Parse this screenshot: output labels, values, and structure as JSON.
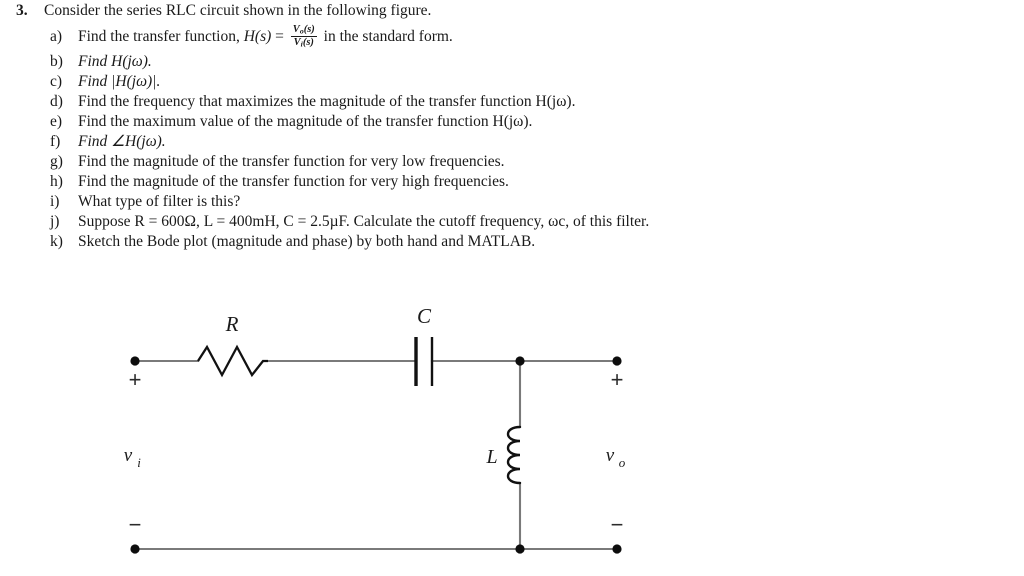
{
  "problem": {
    "number": "3.",
    "statement": "Consider the series RLC circuit shown in the following figure.",
    "parts": [
      {
        "marker": "a)",
        "text_before": "Find the transfer function, ",
        "math_lead": "H(s)",
        "equals": " = ",
        "fraction_numerator": "V",
        "fraction_numerator_sub": "o",
        "fraction_numerator_arg": "(s)",
        "fraction_denominator": "V",
        "fraction_denominator_sub": "i",
        "fraction_denominator_arg": "(s)",
        "text_after": " in the standard form."
      },
      {
        "marker": "b)",
        "text": "Find H(jω)."
      },
      {
        "marker": "c)",
        "text": "Find |H(jω)|."
      },
      {
        "marker": "d)",
        "text": "Find the frequency that maximizes the magnitude of the transfer function H(jω)."
      },
      {
        "marker": "e)",
        "text": "Find the maximum value of the magnitude of the transfer function H(jω)."
      },
      {
        "marker": "f)",
        "text": "Find ∠H(jω)."
      },
      {
        "marker": "g)",
        "text": "Find the magnitude of the transfer function for very low frequencies."
      },
      {
        "marker": "h)",
        "text": "Find the magnitude of the transfer function for very high frequencies."
      },
      {
        "marker": "i)",
        "text": "What type of filter is this?"
      },
      {
        "marker": "j)",
        "text": "Suppose R = 600Ω, L = 400mH, C = 2.5µF. Calculate the cutoff frequency, ωc, of this filter."
      },
      {
        "marker": "k)",
        "text": "Sketch the Bode plot (magnitude and phase) by both hand and MATLAB."
      }
    ]
  },
  "circuit": {
    "title": "series RLC circuit",
    "components": {
      "resistor_label": "R",
      "capacitor_label": "C",
      "inductor_label": "L"
    },
    "port_labels": {
      "input_voltage": "v",
      "input_voltage_sub": "i",
      "output_voltage": "v",
      "output_voltage_sub": "o"
    },
    "polarity": {
      "input_positive": "+",
      "input_negative": "−",
      "output_positive": "+",
      "output_negative": "−"
    },
    "given_values": {
      "R": "600Ω",
      "L": "400mH",
      "C": "2.5µF"
    },
    "topology": "R in series, C in series, L shunt to ground; output across L"
  },
  "colors": {
    "ink": "#1a1a1a",
    "wire": "#7a7a7a",
    "component": "#111111",
    "background": "#ffffff"
  }
}
